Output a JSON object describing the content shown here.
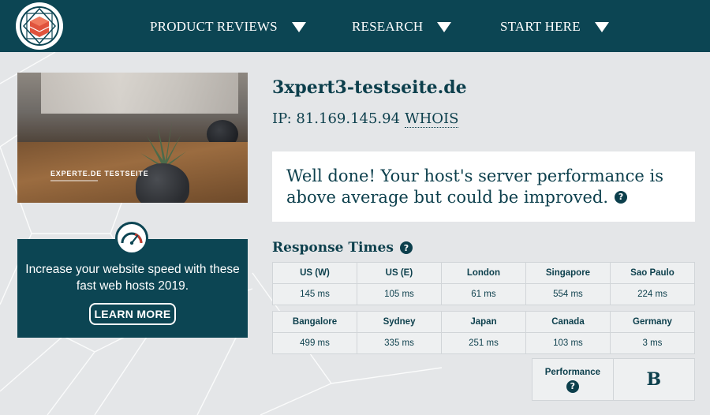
{
  "nav": {
    "items": [
      {
        "label": "PRODUCT REVIEWS"
      },
      {
        "label": "RESEARCH"
      },
      {
        "label": "START HERE"
      }
    ]
  },
  "hero": {
    "title": "EXPERTE.DE TESTSEITE"
  },
  "promo": {
    "text": "Increase your website speed with these fast web hosts 2019.",
    "button_label": "LEARN MORE"
  },
  "site": {
    "domain": "3xpert3-testseite.de",
    "ip_label": "IP: 81.169.145.94",
    "whois_label": "WHOIS"
  },
  "result": {
    "message": "Well done! Your host's server performance is above average but could be improved."
  },
  "response_times": {
    "heading": "Response Times",
    "rows": [
      [
        {
          "city": "US (W)",
          "ms": "145 ms"
        },
        {
          "city": "US (E)",
          "ms": "105 ms"
        },
        {
          "city": "London",
          "ms": "61 ms"
        },
        {
          "city": "Singapore",
          "ms": "554 ms"
        },
        {
          "city": "Sao Paulo",
          "ms": "224 ms"
        }
      ],
      [
        {
          "city": "Bangalore",
          "ms": "499 ms"
        },
        {
          "city": "Sydney",
          "ms": "335 ms"
        },
        {
          "city": "Japan",
          "ms": "251 ms"
        },
        {
          "city": "Canada",
          "ms": "103 ms"
        },
        {
          "city": "Germany",
          "ms": "3 ms"
        }
      ]
    ]
  },
  "performance": {
    "label": "Performance",
    "grade": "B"
  },
  "icons": {
    "help": "question-circle-icon",
    "nav_caret": "caret-down-icon",
    "logo": "experte-logo-icon",
    "gauge": "speed-gauge-icon"
  },
  "colors": {
    "brand": "#0c4553",
    "text": "#0c3f4c",
    "background": "#e4e6e8",
    "gauge_red": "#c0392b"
  }
}
